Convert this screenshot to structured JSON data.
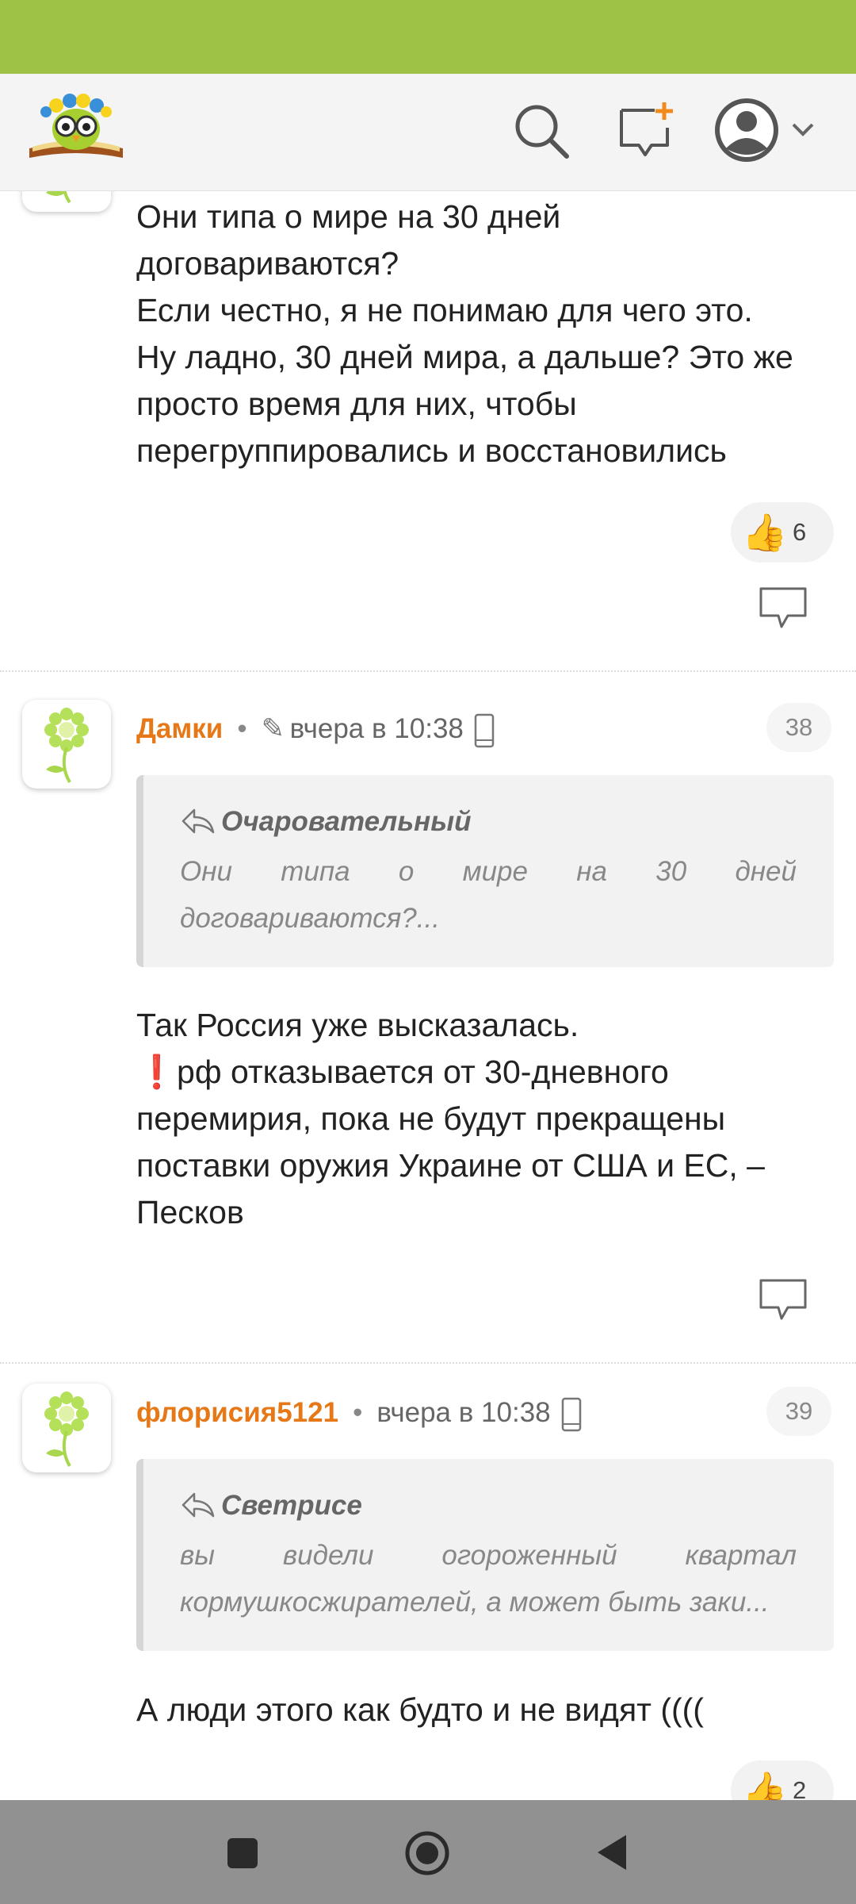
{
  "header": {
    "logo_icon": "owl-on-book-logo",
    "search_icon": "search-icon",
    "new_post_icon": "new-comment-icon",
    "profile_icon": "user-avatar-icon"
  },
  "comments": [
    {
      "text": "Они типа о мире на 30 дней\nдоговариваются?\nЕсли честно, я не понимаю для чего это.\nНу ладно, 30 дней мира, а дальше? Это же\nпросто время для них, чтобы\nперегруппировались и восстановились",
      "likes": "6"
    },
    {
      "author": "Дамки",
      "time": "вчера в 10:38",
      "number": "38",
      "quote_author": "Очаровательный",
      "quote_text": "Они типа о мире на 30 дней договариваются?...",
      "text": "Так Россия уже высказалась.\n❗рф отказывается от 30-дневного\nперемирия, пока не будут прекращены\nпоставки оружия Украине от США и ЕС, –\nПесков"
    },
    {
      "author": "флорисия5121",
      "time": "вчера в 10:38",
      "number": "39",
      "quote_author": "Светрисе",
      "quote_text": "вы видели огороженный квартал кормушкосжирателей, а может быть заки...",
      "text": "А люди этого как будто и не видят ((((",
      "likes": "2"
    }
  ],
  "colors": {
    "status_bar": "#9dc245",
    "author": "#e67817",
    "nav_bar": "#919191"
  }
}
